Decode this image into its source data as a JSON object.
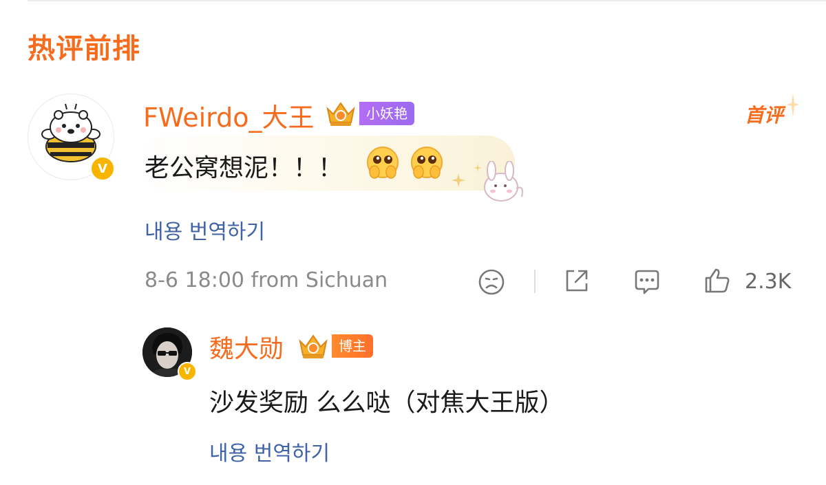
{
  "section": {
    "title": "热评前排"
  },
  "main_comment": {
    "username": "FWeirdo_大王",
    "fan_tag": "小妖艳",
    "first_badge": "首评",
    "text": "老公窝想泥！！！",
    "translate_link": "내용 번역하기",
    "timestamp": "8-6 18:00",
    "location": "from Sichuan",
    "like_count": "2.3K",
    "verified_badge": "V",
    "avatar_icon": "cartoon-bear-avatar",
    "emojis": [
      "pleading-face-icon",
      "pleading-face-icon"
    ],
    "actions": [
      "dislike-icon",
      "share-icon",
      "comment-icon",
      "like-icon"
    ]
  },
  "reply": {
    "username": "魏大勋",
    "author_tag": "博主",
    "text": "沙发奖励 么么哒（对焦大王版）",
    "translate_link": "내용 번역하기",
    "verified_badge": "V",
    "avatar_icon": "person-avatar"
  },
  "colors": {
    "accent": "#f56c1e",
    "link": "#3f63a6",
    "meta": "#8a8a8a",
    "purple_tag": "#a86cf3",
    "verified": "#f7b500"
  }
}
